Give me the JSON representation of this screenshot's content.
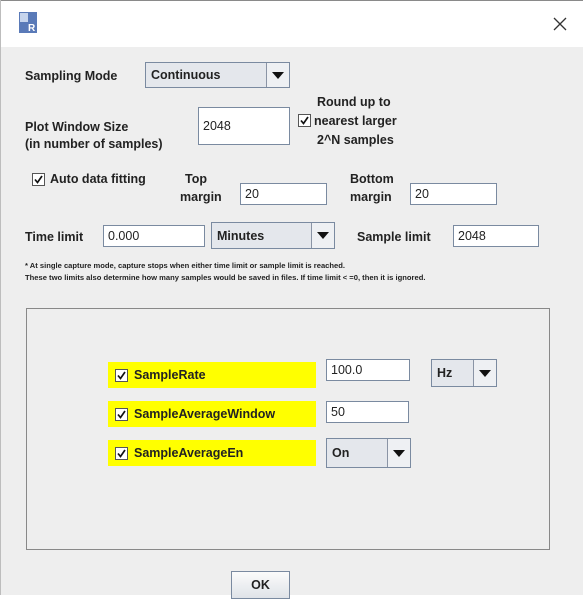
{
  "window": {
    "close_glyph": "×",
    "icon": "r-app-icon",
    "accent": "#5a7ab8"
  },
  "sampling_mode": {
    "label": "Sampling Mode",
    "value": "Continuous"
  },
  "plot_window": {
    "label_line1": "Plot Window Size",
    "label_line2": "(in number of samples)",
    "value": "2048",
    "round_line1": "Round up to",
    "round_line2": "nearest larger",
    "round_line3": "2^N samples",
    "round_checked": true
  },
  "auto_fit": {
    "label": "Auto data fitting",
    "checked": true
  },
  "top_margin": {
    "label_line1": "Top",
    "label_line2": "margin",
    "value": "20"
  },
  "bottom_margin": {
    "label_line1": "Bottom",
    "label_line2": "margin",
    "value": "20"
  },
  "time_limit": {
    "label": "Time limit",
    "value": "0.000",
    "unit": "Minutes"
  },
  "sample_limit": {
    "label": "Sample limit",
    "value": "2048"
  },
  "notes": {
    "line1": "* At single capture mode, capture stops when either time limit or sample limit is reached.",
    "line2": "These two limits also determine how many samples would be saved in files. If time limit < =0, then it is ignored."
  },
  "params": [
    {
      "label": "SampleRate",
      "value": "100.0",
      "unit": "Hz",
      "checked": true
    },
    {
      "label": "SampleAverageWindow",
      "value": "50",
      "checked": true
    },
    {
      "label": "SampleAverageEn",
      "value": "On",
      "checked": true
    }
  ],
  "ok_label": "OK",
  "colors": {
    "highlight": "#ffff00",
    "background": "#eeeeee",
    "combo": "#e4e7ec"
  }
}
